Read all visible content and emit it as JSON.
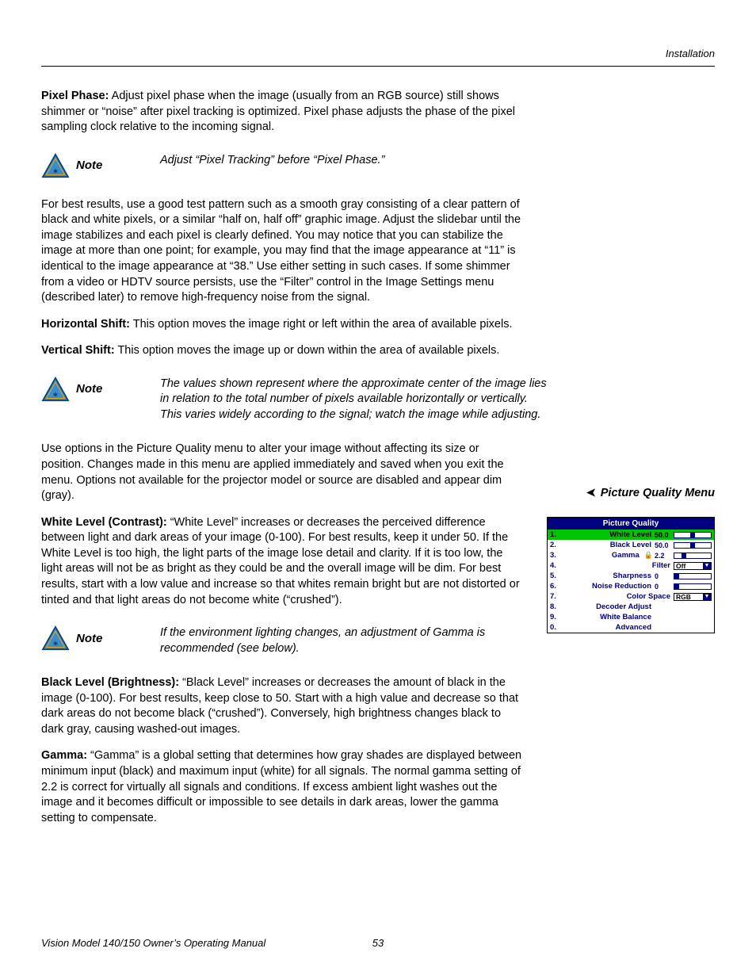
{
  "header": "Installation",
  "p_pixel_phase_label": "Pixel Phase:",
  "p_pixel_phase_text": " Adjust pixel phase when the image (usually from an RGB source) still shows shimmer or “noise” after pixel tracking is optimized. Pixel phase adjusts the phase of the pixel sampling clock relative to the incoming signal.",
  "note_label": "Note",
  "note1": "Adjust “Pixel Tracking” before “Pixel Phase.”",
  "p_best_results": "For best results, use a good test pattern such as a smooth gray consisting of a clear pattern of black and white pixels, or a similar “half on, half off” graphic image. Adjust the slidebar until the image stabilizes and each pixel is clearly defined. You may notice that you can stabilize the image at more than one point; for example, you may find that the image appearance at “11” is identical to the image appearance at “38.” Use either setting in such cases. If some shimmer from a video or HDTV source persists, use the “Filter” control in the Image Settings menu (described later) to remove high-frequency noise from the signal.",
  "p_hshift_label": "Horizontal Shift:",
  "p_hshift_text": " This option moves the image right or left within the area of available pixels.",
  "p_vshift_label": "Vertical Shift:",
  "p_vshift_text": " This option moves the image up or down within the area of available pixels.",
  "note2": "The values shown represent where the approximate center of the image lies in relation to the total number of pixels available horizontally or vertically. This varies widely according to the signal; watch the image while adjusting.",
  "p_pq_intro": "Use options in the Picture Quality menu to alter your image without affecting its size or position. Changes made in this menu are applied immediately and saved when you exit the menu. Options not available for the projector model or source are disabled and appear dim (gray).",
  "side_heading": "Picture Quality Menu",
  "p_white_label": "White Level (Contrast):",
  "p_white_text": " “White Level” increases or decreases the perceived difference between light and dark areas of your image (0-100). For best results, keep it under 50. If the White Level is too high, the light parts of the image lose detail and clarity. If it is too low, the light areas will not be as bright as they could be and the overall image will be dim. For best results, start with a low value and increase so that whites remain bright but are not distorted or tinted and that light areas do not become white (“crushed”).",
  "note3": "If the environment lighting changes, an adjustment of Gamma is recommended (see below).",
  "p_black_label": "Black Level (Brightness):",
  "p_black_text": " “Black Level” increases or decreases the amount of black in the image (0-100). For best results, keep close to 50. Start with a high value and decrease so that dark areas do not become black (“crushed”). Conversely, high brightness changes black to dark gray, causing washed-out images.",
  "p_gamma_label": "Gamma:",
  "p_gamma_text": " “Gamma” is a global setting that determines how gray shades are displayed between minimum input (black) and maximum input (white) for all signals. The normal gamma setting of 2.2 is correct for virtually all signals and conditions. If excess ambient light washes out the image and it becomes difficult or impossible to see details in dark areas, lower the gamma setting to compensate.",
  "menu": {
    "title": "Picture Quality",
    "rows": [
      {
        "num": "1.",
        "label": "White Level",
        "val": "50.0",
        "thumb": 50,
        "sel": true
      },
      {
        "num": "2.",
        "label": "Black Level",
        "val": "50.0",
        "thumb": 50
      },
      {
        "num": "3.",
        "label": "Gamma",
        "lock": true,
        "val": "2.2",
        "thumb": 22
      },
      {
        "num": "4.",
        "label": "Filter",
        "dd": "Off"
      },
      {
        "num": "5.",
        "label": "Sharpness",
        "val": "0",
        "thumb": 0
      },
      {
        "num": "6.",
        "label": "Noise Reduction",
        "val": "0",
        "thumb": 0
      },
      {
        "num": "7.",
        "label": "Color Space",
        "dd": "RGB"
      },
      {
        "num": "8.",
        "label": "Decoder Adjust"
      },
      {
        "num": "9.",
        "label": "White Balance"
      },
      {
        "num": "0.",
        "label": "Advanced"
      }
    ]
  },
  "footer_title": "Vision Model 140/150 Owner’s Operating Manual",
  "footer_page": "53"
}
